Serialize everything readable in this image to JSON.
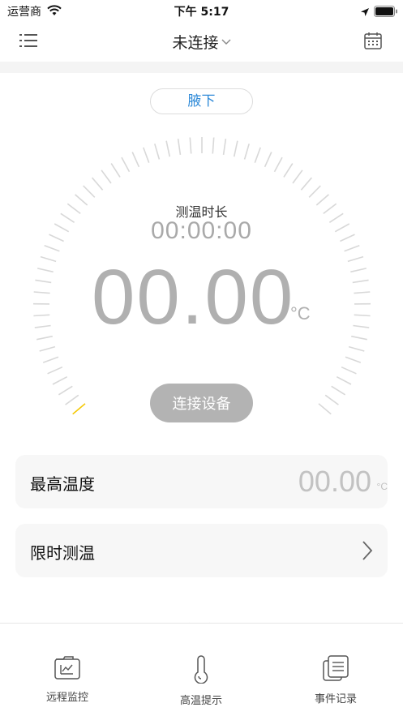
{
  "status_bar": {
    "carrier": "运营商",
    "time": "下午 5:17",
    "icons": [
      "wifi-icon",
      "location-arrow-icon",
      "battery-icon"
    ]
  },
  "nav_bar": {
    "title": "未连接",
    "left_icon": "list-menu-icon",
    "right_icon": "calendar-icon"
  },
  "measurement": {
    "position": "腋下",
    "duration_label": "测温时长",
    "duration_value": "00:00:00",
    "temperature": "00.00",
    "unit": "°C",
    "connect_label": "连接设备"
  },
  "cards": {
    "max_temp": {
      "label": "最高温度",
      "value": "00.00",
      "unit": "°C"
    },
    "timed_measure": {
      "label": "限时测温"
    }
  },
  "tabs": [
    {
      "label": "远程监控",
      "icon": "remote-monitor-icon"
    },
    {
      "label": "高温提示",
      "icon": "thermometer-icon"
    },
    {
      "label": "事件记录",
      "icon": "event-log-icon"
    }
  ],
  "colors": {
    "accent": "#2f8ad8",
    "tick": "#d8d8d8",
    "tick_active": "#f5c800",
    "button": "#b3b3b3",
    "value": "#b0b0b0"
  }
}
